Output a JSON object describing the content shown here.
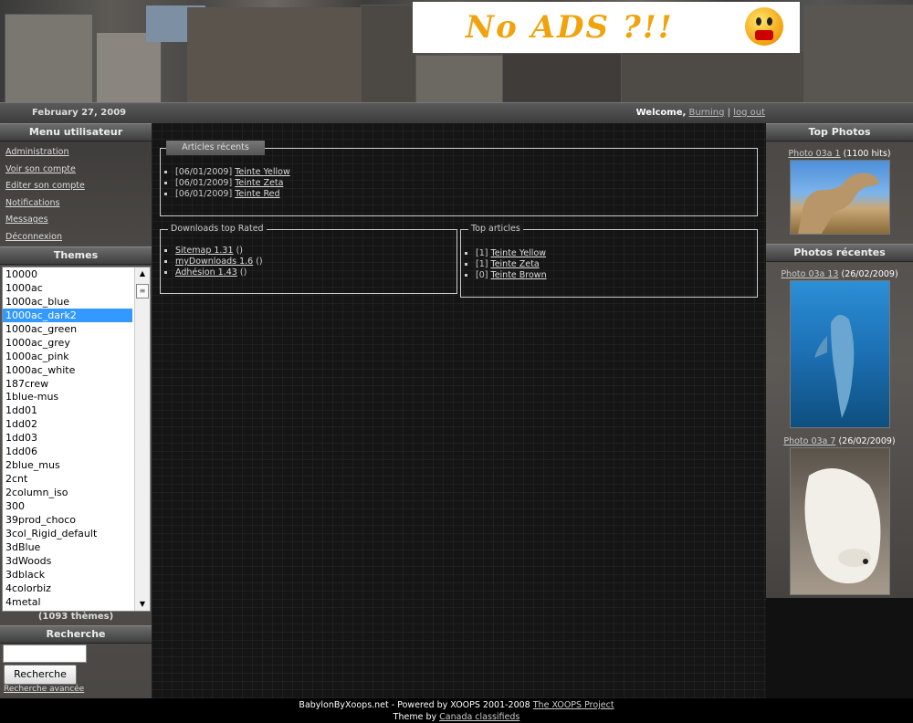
{
  "ad": {
    "text": "No ADS ?!!"
  },
  "datebar": {
    "date": "February 27, 2009",
    "welcome_label": "Welcome,",
    "user": "Burning",
    "separator": "|",
    "logout": "log out"
  },
  "left": {
    "menu_title": "Menu utilisateur",
    "menu_items": [
      "Administration",
      "Voir son compte",
      "Editer son compte",
      "Notifications",
      "Messages",
      "Déconnexion"
    ],
    "themes_title": "Themes",
    "themes": [
      "10000",
      "1000ac",
      "1000ac_blue",
      "1000ac_dark2",
      "1000ac_green",
      "1000ac_grey",
      "1000ac_pink",
      "1000ac_white",
      "187crew",
      "1blue-mus",
      "1dd01",
      "1dd02",
      "1dd03",
      "1dd06",
      "2blue_mus",
      "2cnt",
      "2column_iso",
      "300",
      "39prod_choco",
      "3col_Rigid_default",
      "3dBlue",
      "3dWoods",
      "3dblack",
      "4colorbiz",
      "4metal"
    ],
    "selected_theme": "1000ac_dark2",
    "themes_count": "(1093 thèmes)",
    "search_title": "Recherche",
    "search_value": "",
    "search_button": "Recherche",
    "advanced_search": "Recherche avancée"
  },
  "main": {
    "recent": {
      "title": "Articles récents",
      "items": [
        {
          "date": "[06/01/2009]",
          "link": "Teinte Yellow"
        },
        {
          "date": "[06/01/2009]",
          "link": "Teinte Zeta"
        },
        {
          "date": "[06/01/2009]",
          "link": "Teinte Red"
        }
      ]
    },
    "downloads": {
      "title": "Downloads top Rated",
      "items": [
        {
          "link": "Sitemap 1.31",
          "suffix": "()"
        },
        {
          "link": "myDownloads 1.6",
          "suffix": "()"
        },
        {
          "link": "Adhésion 1.43",
          "suffix": "()"
        }
      ]
    },
    "top_articles": {
      "title": "Top articles",
      "items": [
        {
          "count": "[1]",
          "link": "Teinte Yellow"
        },
        {
          "count": "[1]",
          "link": "Teinte Zeta"
        },
        {
          "count": "[0]",
          "link": "Teinte Brown"
        }
      ]
    }
  },
  "right": {
    "top_title": "Top Photos",
    "top_photo": {
      "link": "Photo 03a 1",
      "meta": "(1100 hits)"
    },
    "recent_title": "Photos récentes",
    "recent_photos": [
      {
        "link": "Photo 03a 13",
        "meta": "(26/02/2009)"
      },
      {
        "link": "Photo 03a 7",
        "meta": "(26/02/2009)"
      }
    ]
  },
  "footer": {
    "line1": "BabylonByXoops.net - Powered by XOOPS 2001-2008",
    "line1_link": "The XOOPS Project",
    "line2": "Theme by",
    "line2_link": "Canada classifieds"
  }
}
